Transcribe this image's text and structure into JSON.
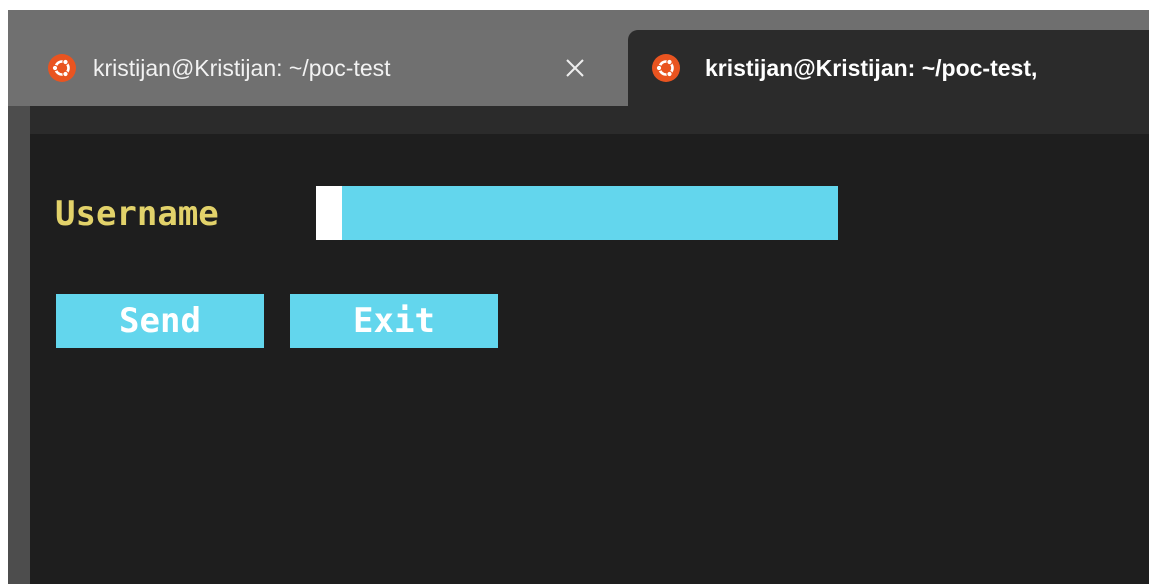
{
  "tabs": [
    {
      "title": "kristijan@Kristijan: ~/poc-test",
      "icon": "ubuntu-icon",
      "active": false,
      "close_icon": "close-icon"
    },
    {
      "title": "kristijan@Kristijan: ~/poc-test,",
      "icon": "ubuntu-icon",
      "active": true
    }
  ],
  "form": {
    "username_label": "Username",
    "username_value": "",
    "send_label": "Send",
    "exit_label": "Exit"
  },
  "colors": {
    "label": "#e2d26a",
    "field_bg": "#63d6ed",
    "button_bg": "#63d6ed",
    "button_text": "#ffffff",
    "terminal_bg": "#1e1e1e",
    "ubuntu": "#e95420"
  }
}
